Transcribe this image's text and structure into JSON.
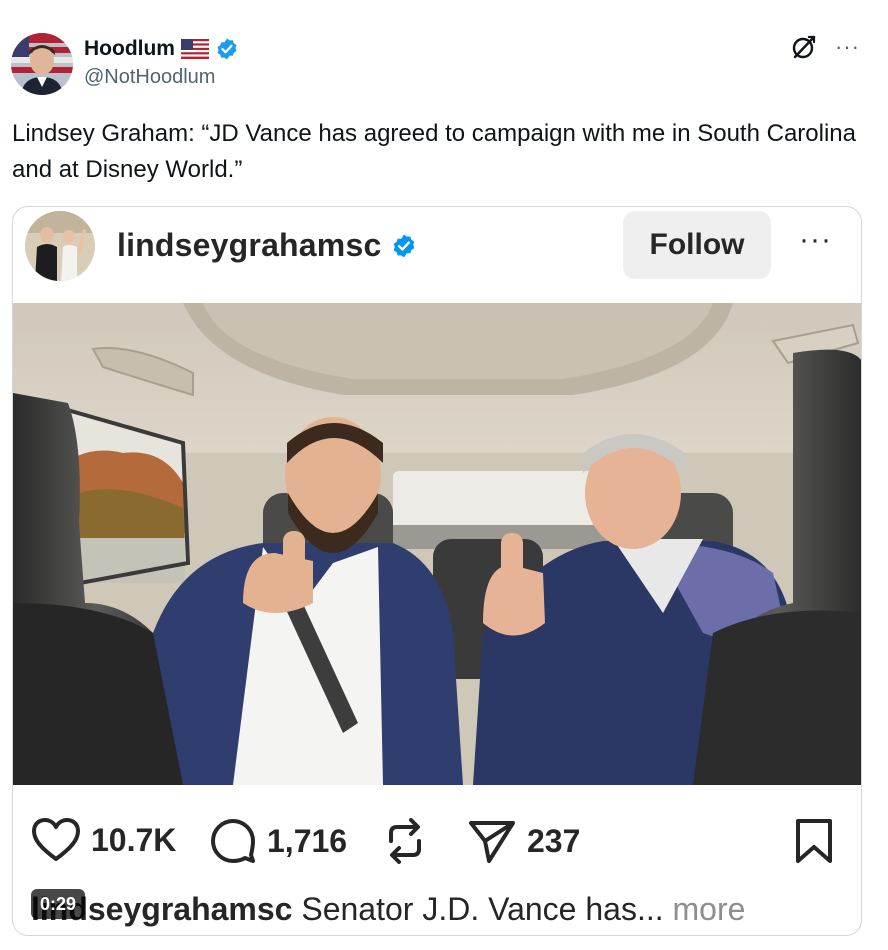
{
  "author": {
    "display_name": "Hoodlum",
    "handle": "@NotHoodlum",
    "flag_icon": "us-flag-icon",
    "verified_color": "#1d9bf0"
  },
  "tweet": {
    "text": "Lindsey Graham: “JD Vance has agreed to campaign with me in South Carolina and at Disney World.”"
  },
  "embed": {
    "username": "lindseygrahamsc",
    "follow_label": "Follow",
    "likes": "10.7K",
    "comments": "1,716",
    "shares": "237",
    "caption_user": "lindseygrahamsc",
    "caption_text": " Senator J.D. Vance has... ",
    "caption_more": "more",
    "video_time": "0:29"
  },
  "colors": {
    "text_primary": "#0f1419",
    "text_secondary": "#536471",
    "ig_text": "#262626",
    "ig_button_bg": "#efefef",
    "ig_verified": "#0095f6",
    "border": "#cfd9de"
  }
}
